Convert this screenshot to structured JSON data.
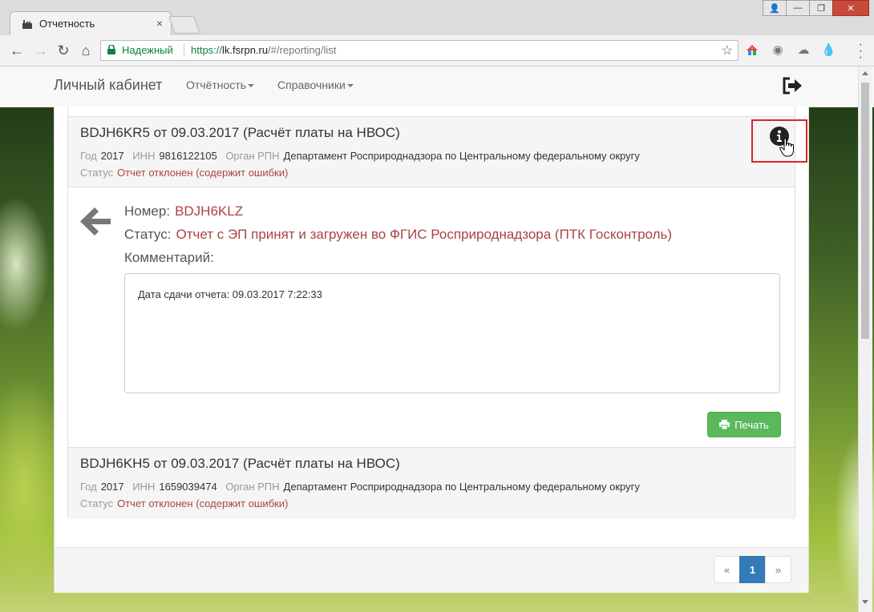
{
  "browser": {
    "tab_title": "Отчетность",
    "tab_close": "×",
    "secure_label": "Надежный",
    "url_proto": "https://",
    "url_host": "lk.fsrpn.ru",
    "url_path": "/#/reporting/list",
    "window_buttons": {
      "user": "👤",
      "minimize": "—",
      "maximize": "❐",
      "close": "✕"
    }
  },
  "navbar": {
    "brand": "Личный кабинет",
    "menu_reporting": "Отчётность",
    "menu_references": "Справочники"
  },
  "reports": [
    {
      "title": "BDJH6KR5 от 09.03.2017 (Расчёт платы на НВОС)",
      "year_label": "Год",
      "year": "2017",
      "inn_label": "ИНН",
      "inn": "9816122105",
      "organ_label": "Орган РПН",
      "organ": "Департамент Росприроднадзора по Центральному федеральному округу",
      "status_label": "Статус",
      "status": "Отчет отклонен (содержит ошибки)"
    },
    {
      "title": "BDJH6KH5 от 09.03.2017 (Расчёт платы на НВОС)",
      "year_label": "Год",
      "year": "2017",
      "inn_label": "ИНН",
      "inn": "1659039474",
      "organ_label": "Орган РПН",
      "organ": "Департамент Росприроднадзора по Центральному федеральному округу",
      "status_label": "Статус",
      "status": "Отчет отклонен (содержит ошибки)"
    }
  ],
  "detail": {
    "number_label": "Номер:",
    "number": "BDJH6KLZ",
    "status_label": "Статус:",
    "status": "Отчет с ЭП принят и загружен во ФГИС Росприроднадзора (ПТК Госконтроль)",
    "comment_label": "Комментарий:",
    "comment": "Дата сдачи отчета: 09.03.2017 7:22:33",
    "print_button": "Печать"
  },
  "pagination": {
    "prev": "«",
    "current": "1",
    "next": "»"
  },
  "colors": {
    "error_red": "#a94442",
    "print_green": "#5cb85c",
    "active_blue": "#337ab7",
    "highlight_box": "#d9262a"
  }
}
